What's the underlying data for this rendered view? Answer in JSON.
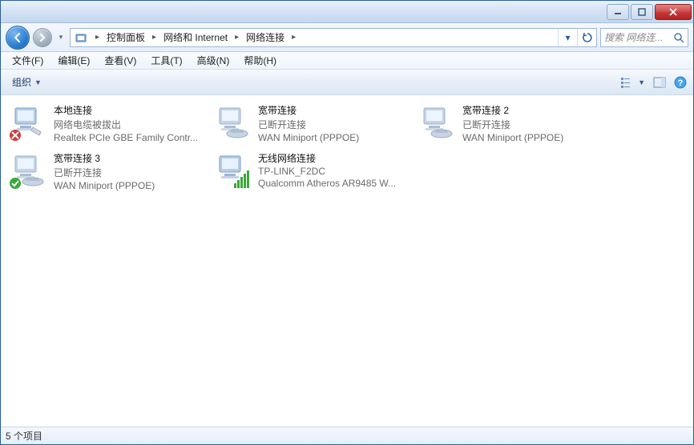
{
  "titlebar": {
    "min": "—",
    "max": "▢",
    "close": "✕"
  },
  "breadcrumbs": {
    "prefix_icon": "control-panel",
    "segments": [
      "控制面板",
      "网络和 Internet",
      "网络连接"
    ]
  },
  "search": {
    "placeholder": "搜索 网络连..."
  },
  "menu": {
    "items": [
      "文件(F)",
      "编辑(E)",
      "查看(V)",
      "工具(T)",
      "高级(N)",
      "帮助(H)"
    ]
  },
  "orgbar": {
    "organize": "组织"
  },
  "connections": [
    {
      "name": "本地连接",
      "status": "网络电缆被拔出",
      "device": "Realtek PCIe GBE Family Contr...",
      "icon": "ethernet",
      "overlay": "error"
    },
    {
      "name": "宽带连接",
      "status": "已断开连接",
      "device": "WAN Miniport (PPPOE)",
      "icon": "dialup",
      "overlay": null
    },
    {
      "name": "宽带连接 2",
      "status": "已断开连接",
      "device": "WAN Miniport (PPPOE)",
      "icon": "dialup",
      "overlay": null
    },
    {
      "name": "宽带连接 3",
      "status": "已断开连接",
      "device": "WAN Miniport (PPPOE)",
      "icon": "dialup",
      "overlay": "ok"
    },
    {
      "name": "无线网络连接",
      "status": "TP-LINK_F2DC",
      "device": "Qualcomm Atheros AR9485 W...",
      "icon": "wifi",
      "overlay": null
    }
  ],
  "statusbar": {
    "text": "5 个项目"
  }
}
